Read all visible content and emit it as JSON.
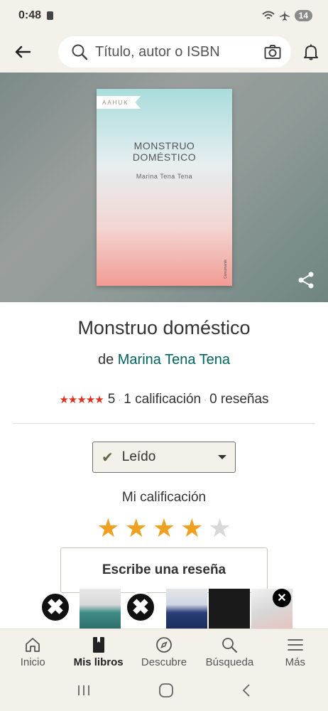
{
  "status_bar": {
    "time": "0:48",
    "battery": "14"
  },
  "search": {
    "placeholder": "Título, autor o ISBN"
  },
  "book": {
    "cover": {
      "publisher_tag": "AAHUK",
      "title_line1": "MONSTRUO",
      "title_line2": "DOMÉSTICO",
      "author": "Marina Tena Tena",
      "spine": "Consonante"
    },
    "title": "Monstruo doméstico",
    "author_prefix": "de",
    "author": "Marina Tena Tena",
    "rating_stars": "★★★★★",
    "rating_value": "5",
    "ratings_count": "1 calificación",
    "reviews_count": "0 reseñas"
  },
  "shelf": {
    "label": "Leído"
  },
  "my_rating": {
    "label": "Mi calificación",
    "value": 4,
    "max": 5
  },
  "review_button": "Escribe una reseña",
  "bottom_nav": {
    "items": [
      {
        "label": "Inicio",
        "icon": "home-icon"
      },
      {
        "label": "Mis libros",
        "icon": "book-icon"
      },
      {
        "label": "Descubre",
        "icon": "compass-icon"
      },
      {
        "label": "Búsqueda",
        "icon": "search-icon"
      },
      {
        "label": "Más",
        "icon": "menu-icon"
      }
    ],
    "active_index": 1
  },
  "colors": {
    "accent_green": "#00635d",
    "star_orange": "#f0a020",
    "star_red": "#e0301e",
    "beige": "#f4f1ea"
  }
}
